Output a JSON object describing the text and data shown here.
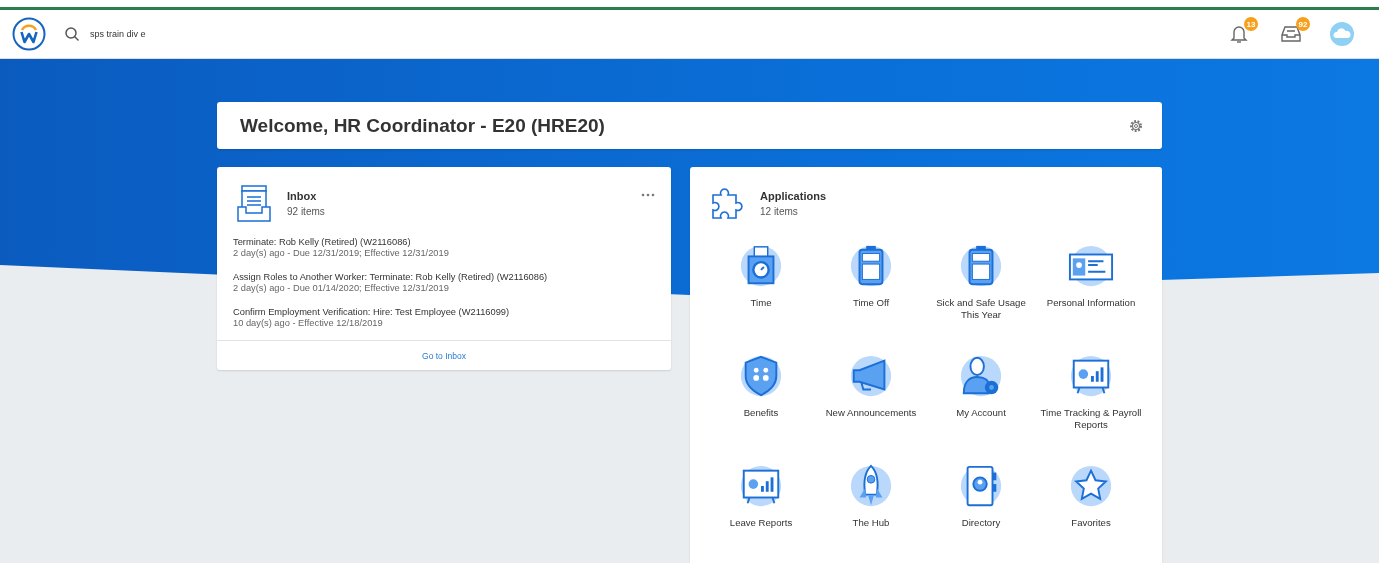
{
  "header": {
    "search": {
      "value": "sps train div e"
    },
    "notifications": {
      "count": "13"
    },
    "inbox": {
      "count": "92"
    }
  },
  "welcome": {
    "title": "Welcome, HR Coordinator - E20 (HRE20)"
  },
  "inbox_card": {
    "title": "Inbox",
    "subtitle": "92 items",
    "items": [
      {
        "title": "Terminate: Rob Kelly (Retired) (W2116086)",
        "detail": "2 day(s) ago - Due 12/31/2019; Effective 12/31/2019"
      },
      {
        "title": "Assign Roles to Another Worker: Terminate: Rob Kelly (Retired) (W2116086)",
        "detail": "2 day(s) ago - Due 01/14/2020; Effective 12/31/2019"
      },
      {
        "title": "Confirm Employment Verification: Hire: Test Employee (W2116099)",
        "detail": "10 day(s) ago - Effective 12/18/2019"
      }
    ],
    "link": "Go to Inbox"
  },
  "applications": {
    "title": "Applications",
    "subtitle": "12 items",
    "items": [
      {
        "label": "Time"
      },
      {
        "label": "Time Off"
      },
      {
        "label": "Sick and Safe Usage This Year"
      },
      {
        "label": "Personal Information"
      },
      {
        "label": "Benefits"
      },
      {
        "label": "New Announcements"
      },
      {
        "label": "My Account"
      },
      {
        "label": "Time Tracking & Payroll Reports"
      },
      {
        "label": "Leave Reports"
      },
      {
        "label": "The Hub"
      },
      {
        "label": "Directory"
      },
      {
        "label": "Favorites"
      }
    ]
  }
}
